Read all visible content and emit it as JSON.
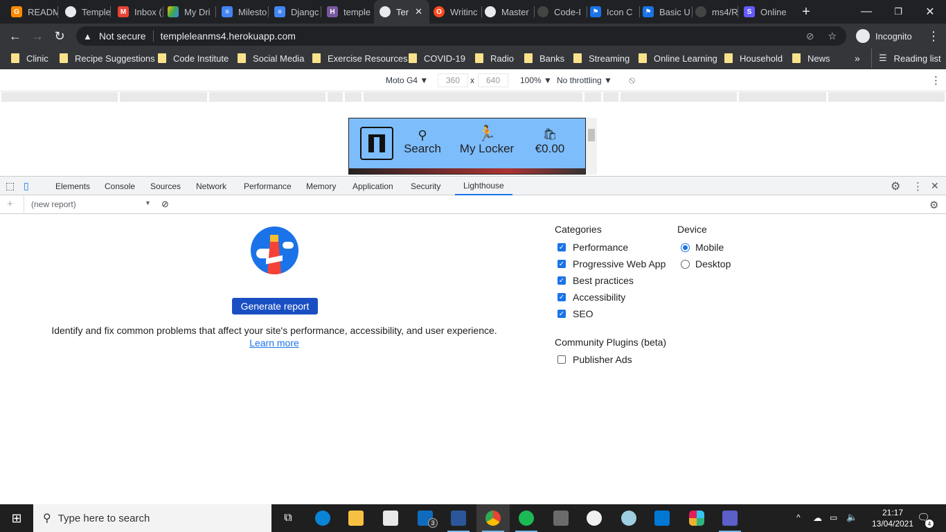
{
  "browser": {
    "tabs": [
      {
        "label": "READM",
        "icon": "gitpod-icon",
        "color": "#ff8a00"
      },
      {
        "label": "Temple",
        "icon": "globe-icon",
        "color": "#e8eaed"
      },
      {
        "label": "Inbox (",
        "icon": "gmail-icon",
        "color": "#ea4335"
      },
      {
        "label": "My Dri",
        "icon": "drive-icon",
        "color": "#34a853"
      },
      {
        "label": "Milesto",
        "icon": "docs-icon",
        "color": "#4285f4"
      },
      {
        "label": "Djangc",
        "icon": "docs-icon",
        "color": "#4285f4"
      },
      {
        "label": "temple",
        "icon": "heroku-icon",
        "color": "#79589f"
      },
      {
        "label": "Ter",
        "icon": "globe-icon",
        "color": "#e8eaed"
      },
      {
        "label": "Writinc",
        "icon": "opera-icon",
        "color": "#ff4b1f"
      },
      {
        "label": "Master",
        "icon": "github-icon",
        "color": "#e8eaed"
      },
      {
        "label": "Code-I",
        "icon": "github-icon",
        "color": "#444"
      },
      {
        "label": "Icon C",
        "icon": "flag-icon",
        "color": "#1a73e8"
      },
      {
        "label": "Basic U",
        "icon": "flag-icon",
        "color": "#1a73e8"
      },
      {
        "label": "ms4/R",
        "icon": "github-icon",
        "color": "#444"
      },
      {
        "label": "Online",
        "icon": "stripe-icon",
        "color": "#635bff"
      }
    ],
    "active_tab_index": 7,
    "url": "templeleanms4.herokuapp.com",
    "security": "Not secure",
    "profile": "Incognito",
    "bookmarks": [
      "Clinic",
      "Recipe Suggestions",
      "Code Institute",
      "Social Media",
      "Exercise Resources",
      "COVID-19",
      "Radio",
      "Banks",
      "Streaming",
      "Online Learning",
      "Household",
      "News"
    ],
    "reading_list": "Reading list",
    "overflow": "»"
  },
  "device_toolbar": {
    "device": "Moto G4 ▼",
    "width": "360",
    "height": "640",
    "times": "x",
    "zoom": "100% ▼",
    "throttling": "No throttling ▼"
  },
  "site": {
    "nav": [
      "Search",
      "My Locker",
      "€0.00"
    ]
  },
  "devtools": {
    "tabs": [
      "Elements",
      "Console",
      "Sources",
      "Network",
      "Performance",
      "Memory",
      "Application",
      "Security",
      "Lighthouse"
    ],
    "active_tab": "Lighthouse",
    "report_select": "(new report)",
    "generate_label": "Generate report",
    "description": "Identify and fix common problems that affect your site's performance, accessibility, and user experience.",
    "learn_more": "Learn more",
    "categories_title": "Categories",
    "categories": [
      {
        "label": "Performance",
        "checked": true
      },
      {
        "label": "Progressive Web App",
        "checked": true
      },
      {
        "label": "Best practices",
        "checked": true
      },
      {
        "label": "Accessibility",
        "checked": true
      },
      {
        "label": "SEO",
        "checked": true
      }
    ],
    "device_title": "Device",
    "device_options": [
      {
        "label": "Mobile",
        "selected": true
      },
      {
        "label": "Desktop",
        "selected": false
      }
    ],
    "plugins_title": "Community Plugins (beta)",
    "plugins": [
      {
        "label": "Publisher Ads",
        "checked": false
      }
    ]
  },
  "taskbar": {
    "search_placeholder": "Type here to search",
    "time": "21:17",
    "date": "13/04/2021",
    "mail_badge": "3",
    "notification_count": "4"
  }
}
